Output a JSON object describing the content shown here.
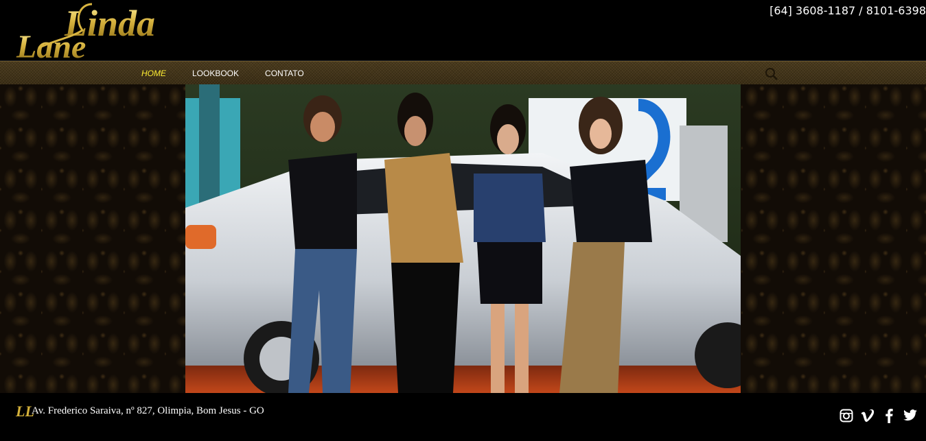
{
  "header": {
    "logo_text_line1": "Linda",
    "logo_text_line2": "Lane",
    "phone": "[64] 3608-1187 / 8101-6398"
  },
  "nav": {
    "items": [
      {
        "label": "HOME",
        "active": true
      },
      {
        "label": "LOOKBOOK",
        "active": false
      },
      {
        "label": "CONTATO",
        "active": false
      }
    ],
    "search_icon": "search-icon"
  },
  "hero": {
    "description_icon": "hero-photo"
  },
  "footer": {
    "logo_monogram": "LL",
    "address": "Av. Frederico Saraiva, nº 827, Olimpia, Bom Jesus - GO",
    "social": [
      "instagram-icon",
      "vimeo-icon",
      "facebook-icon",
      "twitter-icon"
    ]
  },
  "colors": {
    "gold": "#d4b13a",
    "nav_active": "#ffee33",
    "nav_bg": "#4a3a1c"
  }
}
